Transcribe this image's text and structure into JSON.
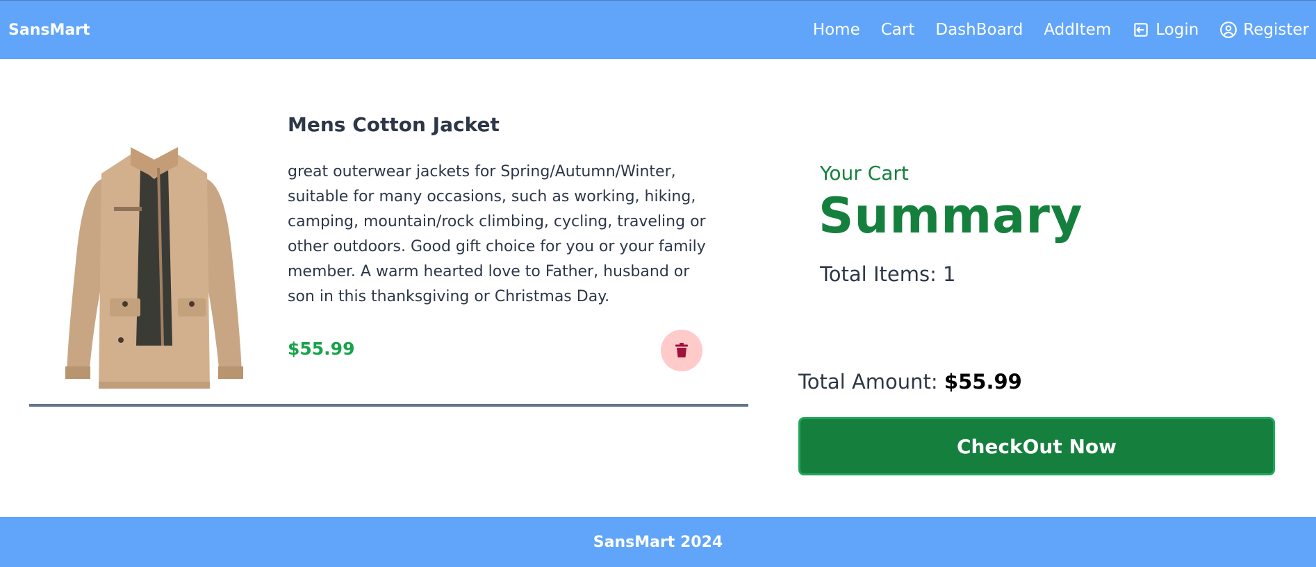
{
  "navbar": {
    "brand": "SansMart",
    "links": [
      {
        "label": "Home"
      },
      {
        "label": "Cart"
      },
      {
        "label": "DashBoard"
      },
      {
        "label": "AddItem"
      },
      {
        "label": "Login",
        "icon": "login-icon"
      },
      {
        "label": "Register",
        "icon": "user-circle-icon"
      }
    ],
    "background_color": "#60a5fa"
  },
  "cart_item": {
    "image": "jacket-image",
    "title": "Mens Cotton Jacket",
    "description": "great outerwear jackets for Spring/Autumn/Winter, suitable for many occasions, such as working, hiking, camping, mountain/rock climbing, cycling, traveling or other outdoors. Good gift choice for you or your family member. A warm hearted love to Father, husband or son in this thanksgiving or Christmas Day.",
    "price": "$55.99",
    "delete_icon": "trash-icon"
  },
  "summary": {
    "cart_label": "Your Cart",
    "title": "Summary",
    "total_items": "Total Items: 1",
    "total_amount_label": "Total Amount:",
    "total_amount_value": "$55.99",
    "checkout_label": "CheckOut Now",
    "accent_color": "#15803d"
  },
  "footer": {
    "text": "SansMart 2024"
  }
}
